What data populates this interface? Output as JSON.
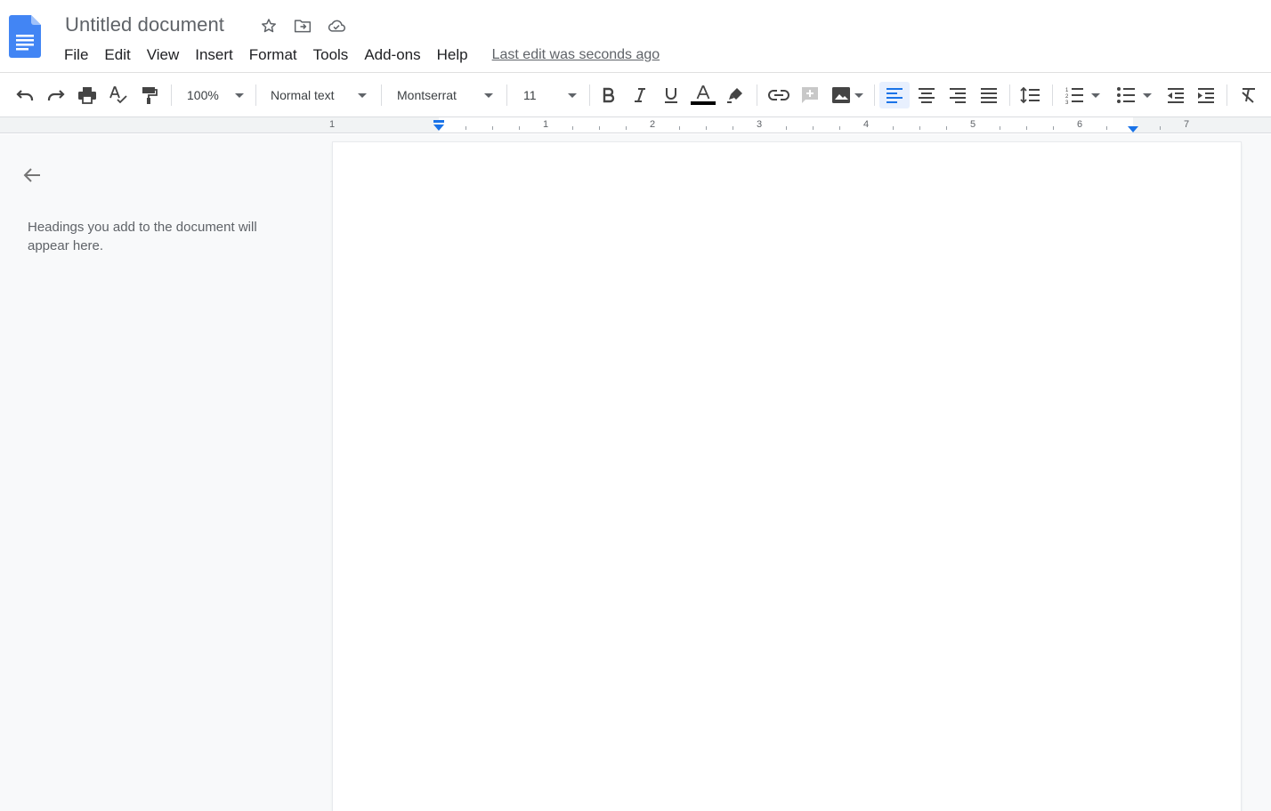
{
  "header": {
    "title": "Untitled document",
    "last_edit": "Last edit was seconds ago",
    "menu": [
      "File",
      "Edit",
      "View",
      "Insert",
      "Format",
      "Tools",
      "Add-ons",
      "Help"
    ]
  },
  "toolbar": {
    "zoom": "100%",
    "style": "Normal text",
    "font": "Montserrat",
    "font_size": "11"
  },
  "ruler": {
    "numbers": [
      "1",
      "1",
      "2",
      "3",
      "4",
      "5",
      "6",
      "7"
    ]
  },
  "outline": {
    "hint": "Headings you add to the document will appear here."
  },
  "colors": {
    "accent": "#1a73e8",
    "docs_blue": "#4285f4",
    "text_color_bar": "#000000"
  }
}
